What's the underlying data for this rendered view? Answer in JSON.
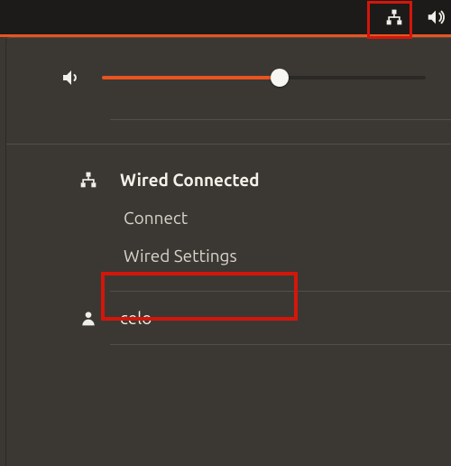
{
  "topbar": {
    "icons": {
      "network": "network-wired-icon",
      "volume": "volume-icon"
    }
  },
  "volume": {
    "level": 55
  },
  "network": {
    "status": "Wired Connected",
    "items": {
      "connect": "Connect",
      "settings": "Wired Settings"
    }
  },
  "user": {
    "name": "celo"
  }
}
